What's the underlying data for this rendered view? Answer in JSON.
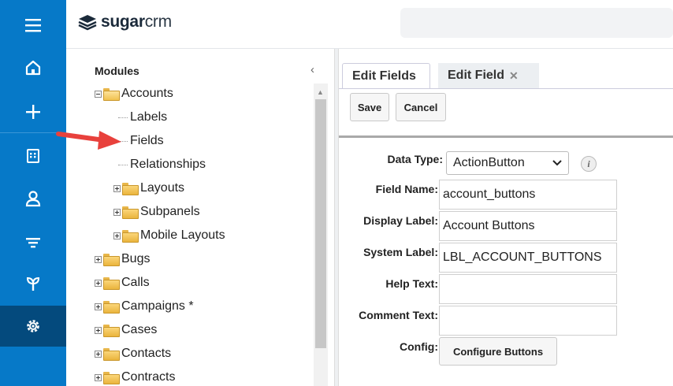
{
  "header": {
    "logo_bold": "sugar",
    "logo_light": "crm"
  },
  "rail": {
    "icons": [
      "menu-icon",
      "home-icon",
      "plus-icon",
      "building-icon",
      "user-icon",
      "filter-icon",
      "plant-icon",
      "gear-icon"
    ],
    "accent": "#0679c8",
    "active_bg": "#044a7d"
  },
  "tree": {
    "title": "Modules",
    "collapse_glyph": "‹",
    "items": [
      {
        "label": "Accounts"
      },
      {
        "label": "Labels"
      },
      {
        "label": "Fields"
      },
      {
        "label": "Relationships"
      },
      {
        "label": "Layouts"
      },
      {
        "label": "Subpanels"
      },
      {
        "label": "Mobile Layouts"
      },
      {
        "label": "Bugs"
      },
      {
        "label": "Calls"
      },
      {
        "label": "Campaigns *"
      },
      {
        "label": "Cases"
      },
      {
        "label": "Contacts"
      },
      {
        "label": "Contracts"
      }
    ]
  },
  "tabs": [
    {
      "label": "Edit Fields"
    },
    {
      "label": "Edit Field",
      "close": "✕"
    }
  ],
  "toolbar": {
    "save_label": "Save",
    "cancel_label": "Cancel"
  },
  "form": {
    "data_type_label": "Data Type:",
    "data_type_value": "ActionButton",
    "info_glyph": "i",
    "field_name_label": "Field Name:",
    "field_name_value": "account_buttons",
    "display_label_label": "Display Label:",
    "display_label_value": "Account Buttons",
    "system_label_label": "System Label:",
    "system_label_value": "LBL_ACCOUNT_BUTTONS",
    "help_text_label": "Help Text:",
    "help_text_value": "",
    "comment_text_label": "Comment Text:",
    "comment_text_value": "",
    "config_label": "Config:",
    "configure_buttons_label": "Configure Buttons"
  }
}
